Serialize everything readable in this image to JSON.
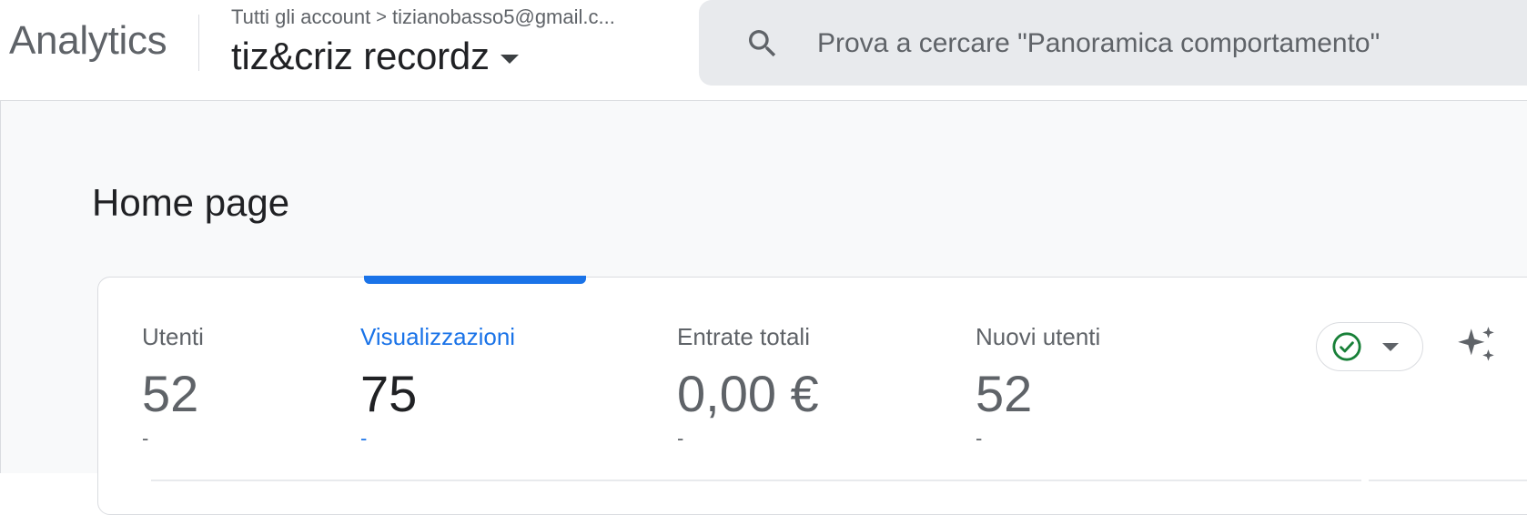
{
  "header": {
    "product_name": "Analytics",
    "breadcrumb": {
      "all_accounts": "Tutti gli account",
      "separator": ">",
      "account": "tizianobasso5@gmail.c..."
    },
    "property_name": "tiz&criz recordz",
    "property_dropdown_icon": "caret-down-icon"
  },
  "search": {
    "icon": "search-icon",
    "placeholder": "Prova a cercare \"Panoramica comportamento\"",
    "value": ""
  },
  "page": {
    "title": "Home page"
  },
  "metrics": {
    "active_tab": "Visualizzazioni",
    "items": [
      {
        "label": "Utenti",
        "value": "52",
        "change": "-"
      },
      {
        "label": "Visualizzazioni",
        "value": "75",
        "change": "-"
      },
      {
        "label": "Entrate totali",
        "value": "0,00 €",
        "change": "-"
      },
      {
        "label": "Nuovi utenti",
        "value": "52",
        "change": "-"
      }
    ]
  },
  "controls": {
    "status_icon": "check-circle-icon",
    "status_dropdown_icon": "caret-down-icon",
    "insights_icon": "sparkle-icon"
  },
  "colors": {
    "accent": "#1a73e8",
    "status_check": "#188038",
    "search_bg": "#e8eaed",
    "content_bg": "#f8f9fa"
  }
}
